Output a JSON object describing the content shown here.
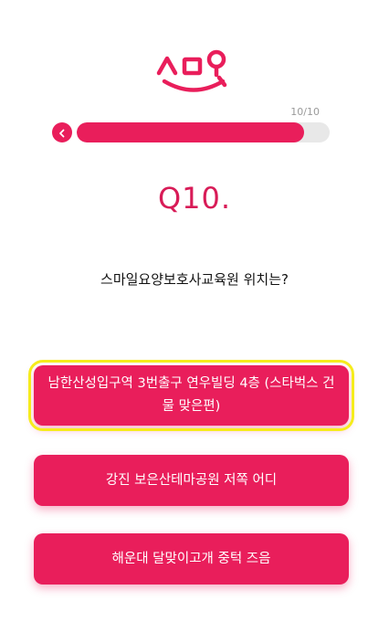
{
  "progress": {
    "counter": "10/10",
    "fraction": 1.0
  },
  "question": {
    "number": "Q10.",
    "text": "스마일요양보호사교육원 위치는?"
  },
  "answers": [
    {
      "label": "남한산성입구역 3번출구 연우빌딩 4층 (스타벅스 건물 맞은편)"
    },
    {
      "label": "강진 보은산테마공원 저쪽 어디"
    },
    {
      "label": "해운대 달맞이고개 중턱 즈음"
    }
  ],
  "colors": {
    "accent": "#e91e5b",
    "track": "#e8e8e8",
    "highlight": "#f5ec1c"
  },
  "icons": {
    "logo": "smile-logo-icon",
    "back": "chevron-left-icon"
  }
}
